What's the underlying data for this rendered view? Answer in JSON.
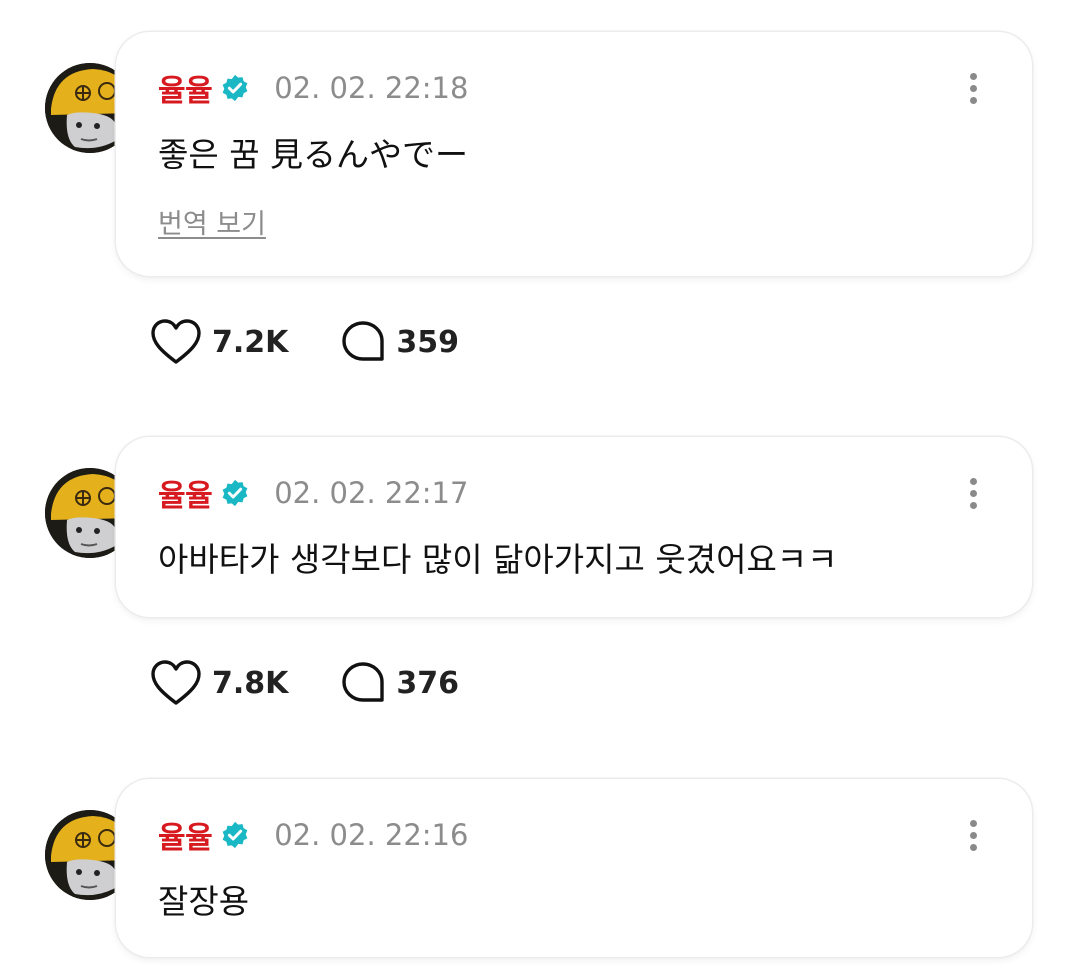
{
  "colors": {
    "username": "#d71920",
    "verified_badge": "#1ab8c4",
    "timestamp": "#8c8c8c",
    "text": "#111111"
  },
  "icons": {
    "verified": "verified-badge-icon",
    "more": "more-vertical-icon",
    "like": "heart-outline-icon",
    "comment": "speech-bubble-icon"
  },
  "posts": [
    {
      "username": "율율",
      "timestamp": "02. 02. 22:18",
      "content": "좋은 꿈 見るんやでー",
      "translate_label": "번역 보기",
      "likes": "7.2K",
      "comments": "359"
    },
    {
      "username": "율율",
      "timestamp": "02. 02. 22:17",
      "content": "아바타가 생각보다 많이 닮아가지고 웃겼어요ㅋㅋ",
      "likes": "7.8K",
      "comments": "376"
    },
    {
      "username": "율율",
      "timestamp": "02. 02. 22:16",
      "content": "잘장용"
    }
  ]
}
